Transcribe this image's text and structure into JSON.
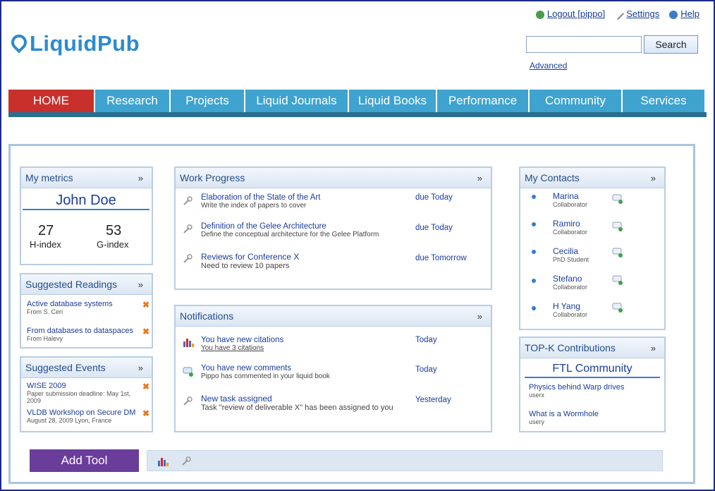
{
  "header": {
    "logout_label": "Logout [pippo]",
    "settings_label": "Settings",
    "help_label": "Help",
    "logo_text": "LiquidPub",
    "search_button": "Search",
    "search_placeholder": "",
    "advanced_label": "Advanced"
  },
  "nav": [
    "HOME",
    "Research",
    "Projects",
    "Liquid Journals",
    "Liquid Books",
    "Performance",
    "Community",
    "Services"
  ],
  "metrics": {
    "title": "My metrics",
    "name": "John Doe",
    "h_value": "27",
    "h_label": "H-index",
    "g_value": "53",
    "g_label": "G-index"
  },
  "readings": {
    "title": "Suggested Readings",
    "items": [
      {
        "title": "Active database systems",
        "sub": "From S. Ceri"
      },
      {
        "title": "From databases to dataspaces",
        "sub": "From Halevy"
      }
    ]
  },
  "events": {
    "title": "Suggested Events",
    "items": [
      {
        "title": "WISE 2009",
        "sub": "Paper submission deadline: May 1st, 2009"
      },
      {
        "title": "VLDB Workshop on Secure DM",
        "sub": "August 28, 2009 Lyon, France"
      }
    ]
  },
  "work": {
    "title": "Work Progress",
    "items": [
      {
        "title": "Elaboration of the State of the Art",
        "sub": "Write the index of papers to cover",
        "due": "due Today"
      },
      {
        "title": "Definition of the Gelee Architecture",
        "sub": "Define the conceptual architecture for the Gelee Platform",
        "due": "due Today"
      },
      {
        "title": "Reviews for Conference X",
        "sub": "Need to review 10 papers",
        "due": "due Tomorrow"
      }
    ]
  },
  "notifications": {
    "title": "Notifications",
    "items": [
      {
        "title": "You have new citations",
        "sub": "You have 3 citations",
        "when": "Today"
      },
      {
        "title": "You have new comments",
        "sub": "Pippo has commented in your liquid book",
        "when": "Today"
      },
      {
        "title": "New task assigned",
        "sub": "Task \"review of deliverable X\" has been assigned to you",
        "when": "Yesterday"
      }
    ]
  },
  "contacts": {
    "title": "My Contacts",
    "items": [
      {
        "name": "Marina",
        "role": "Collaborator"
      },
      {
        "name": "Ramiro",
        "role": "Collaborator"
      },
      {
        "name": "Cecilia",
        "role": "PhD Student"
      },
      {
        "name": "Stefano",
        "role": "Collaborator"
      },
      {
        "name": "H Yang",
        "role": "Collaborator"
      }
    ]
  },
  "topk": {
    "title": "TOP-K Contributions",
    "community": "FTL Community",
    "items": [
      {
        "title": "Physics behind Warp drives",
        "sub": "userx"
      },
      {
        "title": "What is a Wormhole",
        "sub": "usery"
      }
    ]
  },
  "add_tool": "Add Tool",
  "colors": {
    "nav": "#3fa3cf",
    "home": "#c9302c",
    "add_tool": "#6a3d9a",
    "logo": "#2d8ad0"
  }
}
